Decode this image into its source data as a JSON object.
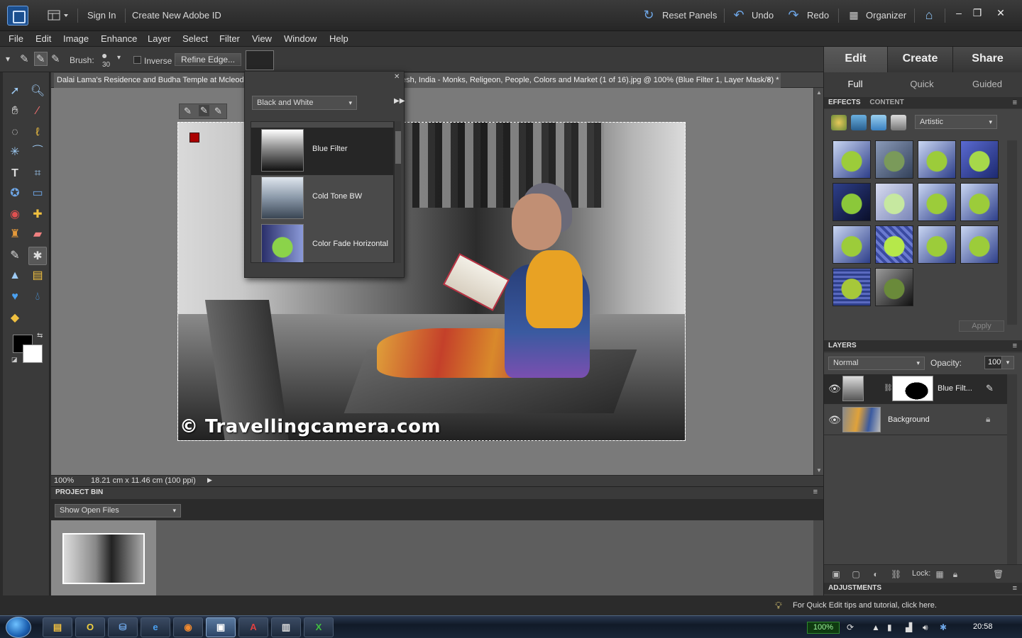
{
  "titlebar": {
    "sign_in": "Sign In",
    "create_id": "Create New Adobe ID",
    "reset_panels": "Reset Panels",
    "undo": "Undo",
    "redo": "Redo",
    "organizer": "Organizer"
  },
  "menubar": [
    "File",
    "Edit",
    "Image",
    "Enhance",
    "Layer",
    "Select",
    "Filter",
    "View",
    "Window",
    "Help"
  ],
  "options": {
    "brush_label": "Brush:",
    "brush_size": "30",
    "inverse_label": "Inverse",
    "refine_edge": "Refine Edge..."
  },
  "document": {
    "tab_title_left": "Dalai Lama's Residence and Budha Temple at Mcleodg",
    "tab_title_right": "esh, India - Monks, Religeon, People, Colors and Market (1 of 16).jpg @ 100% (Blue Filter 1, Layer Mask/8) *",
    "close": "×",
    "watermark": "© Travellingcamera.com",
    "zoom": "100%",
    "dimensions": "18.21 cm x 11.46 cm (100 ppi)"
  },
  "filter_popup": {
    "category": "Black and White",
    "items": [
      {
        "label": "Blue Filter"
      },
      {
        "label": "Cold Tone BW"
      },
      {
        "label": "Color Fade Horizontal"
      }
    ]
  },
  "project_bin": {
    "title": "PROJECT BIN",
    "show": "Show Open Files"
  },
  "right_panel": {
    "tabs": [
      "Edit",
      "Create",
      "Share"
    ],
    "subtabs": [
      "Full",
      "Quick",
      "Guided"
    ],
    "effects_tab": "EFFECTS",
    "content_tab": "CONTENT",
    "effects_filter": "Artistic",
    "apply": "Apply",
    "layers_title": "LAYERS",
    "blend_mode": "Normal",
    "opacity_label": "Opacity:",
    "opacity_value": "100%",
    "layers": [
      {
        "name": "Blue Filt..."
      },
      {
        "name": "Background"
      }
    ],
    "lock_label": "Lock:",
    "adjustments_title": "ADJUSTMENTS"
  },
  "tip": "For Quick Edit tips and tutorial, click here.",
  "taskbar": {
    "battery": "100%",
    "clock": "20:58"
  },
  "colors": {
    "accent": "#6ea6e6",
    "panel": "#3b3b3b",
    "canvas": "#7a7a7a"
  }
}
